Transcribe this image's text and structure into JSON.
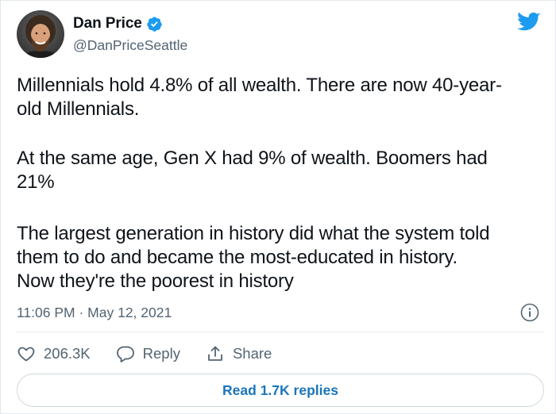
{
  "user": {
    "display_name": "Dan Price",
    "handle": "@DanPriceSeattle",
    "verified": true
  },
  "tweet": {
    "paragraphs": [
      [
        "Millennials hold 4.8% of all wealth. There are now 40-year-",
        "old Millennials."
      ],
      [
        "At the same age, Gen X had 9% of wealth. Boomers had",
        "21%"
      ],
      [
        "The largest generation in history did what the system told",
        "them to do and became the most-educated in history.",
        "Now they're the poorest in history"
      ]
    ],
    "timestamp": "11:06 PM · May 12, 2021"
  },
  "actions": {
    "like_count": "206.3K",
    "reply_label": "Reply",
    "share_label": "Share"
  },
  "replies_button": {
    "label": "Read 1.7K replies"
  },
  "colors": {
    "brand_blue": "#1d9bf0",
    "link_blue": "#1b75bb",
    "text_primary": "#0f1419",
    "text_secondary": "#536471",
    "border": "#cfd9de"
  },
  "icons": [
    "avatar",
    "verified-badge-icon",
    "twitter-bird-icon",
    "info-icon",
    "heart-icon",
    "reply-icon",
    "share-icon"
  ]
}
